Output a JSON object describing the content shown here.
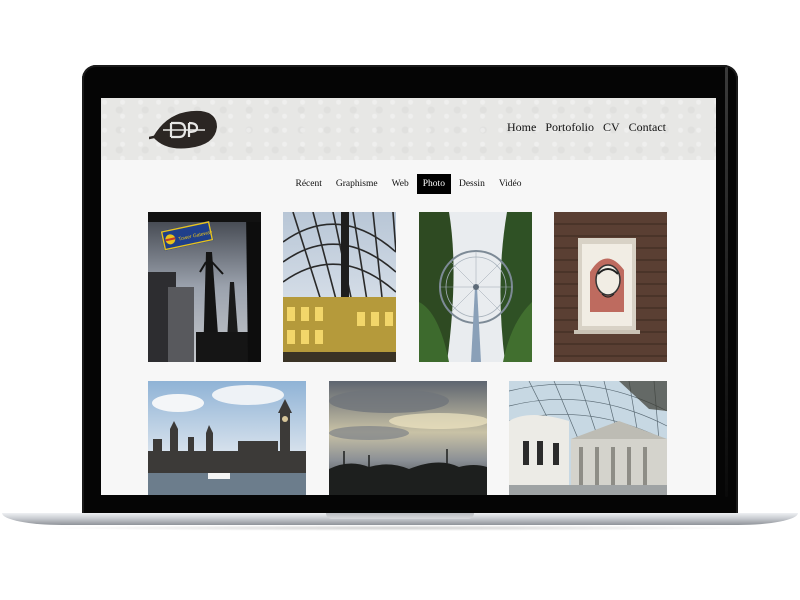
{
  "header": {
    "logo_name": "leaf-logo",
    "nav": [
      {
        "label": "Home"
      },
      {
        "label": "Portofolio"
      },
      {
        "label": "CV"
      },
      {
        "label": "Contact"
      }
    ]
  },
  "filters": {
    "active": "Photo",
    "items": [
      {
        "label": "Récent"
      },
      {
        "label": "Graphisme"
      },
      {
        "label": "Web"
      },
      {
        "label": "Photo"
      },
      {
        "label": "Dessin"
      },
      {
        "label": "Vidéo"
      }
    ]
  },
  "gallery": {
    "photos": [
      {
        "subject": "London docks cranes with Tower Gateway sign",
        "sign_text": "Tower Gateway"
      },
      {
        "subject": "Hay's Galleria glass roof"
      },
      {
        "subject": "London Eye from below"
      },
      {
        "subject": "Che Guevara poster in brick wall window"
      },
      {
        "subject": "Houses of Parliament and Big Ben from the Thames"
      },
      {
        "subject": "Cloudy sunset sky over trees"
      },
      {
        "subject": "British Museum Great Court roof"
      }
    ]
  },
  "colors": {
    "header_bg": "#e7e7e5",
    "active_tab_bg": "#000000",
    "active_tab_text": "#ffffff"
  }
}
